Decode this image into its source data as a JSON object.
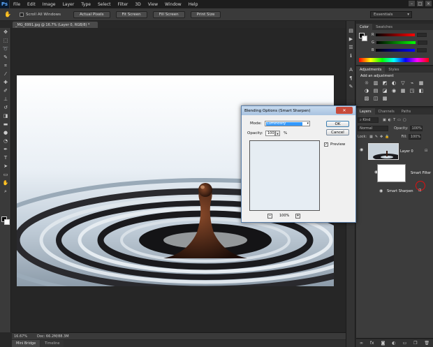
{
  "app": {
    "logo": "Ps"
  },
  "menu": [
    "File",
    "Edit",
    "Image",
    "Layer",
    "Type",
    "Select",
    "Filter",
    "3D",
    "View",
    "Window",
    "Help"
  ],
  "window_controls": [
    "–",
    "□",
    "×"
  ],
  "options_bar": {
    "scroll_all_label": "Scroll All Windows",
    "buttons": [
      "Actual Pixels",
      "Fit Screen",
      "Fill Screen",
      "Print Size"
    ],
    "workspace": "Essentials"
  },
  "document_tab": "_MG_6991.jpg @ 16.7% (Layer 0, RGB/8) *",
  "status": {
    "zoom": "16.67%",
    "doc": "Doc: 66.2M/88.3M"
  },
  "bottom_tabs": [
    "Mini Bridge",
    "Timeline"
  ],
  "color_panel": {
    "tabs": [
      "Color",
      "Swatches"
    ],
    "channels": [
      {
        "name": "R",
        "gradient": "linear-gradient(90deg,#000,#f00)"
      },
      {
        "name": "G",
        "gradient": "linear-gradient(90deg,#000,#0f0)"
      },
      {
        "name": "B",
        "gradient": "linear-gradient(90deg,#000,#00f)"
      }
    ]
  },
  "adjustments_panel": {
    "tabs": [
      "Adjustments",
      "Styles"
    ],
    "title": "Add an adjustment",
    "icons": [
      "☼",
      "▥",
      "◩",
      "◐",
      "▽",
      "⌁",
      "",
      "▦",
      "◑",
      "▤",
      "◪",
      "◉",
      "▦",
      "",
      "◳",
      "◧",
      "▨",
      "◫",
      "▩",
      "",
      ""
    ]
  },
  "layers_panel": {
    "tabs": [
      "Layers",
      "Channels",
      "Paths"
    ],
    "kind": "Kind",
    "blend_mode": "Normal",
    "opacity_label": "Opacity:",
    "opacity_value": "100%",
    "lock_label": "Lock:",
    "fill_label": "Fill:",
    "fill_value": "100%",
    "layer0": "Layer 0",
    "smart_filters": "Smart Filter",
    "smart_sharpen": "Smart Sharpen"
  },
  "dialog": {
    "title": "Blending Options (Smart Sharpen)",
    "close": "✕",
    "mode_label": "Mode:",
    "mode_value": "Luminosity",
    "opacity_label": "Opacity:",
    "opacity_value": "100",
    "opacity_unit": "%",
    "ok": "OK",
    "cancel": "Cancel",
    "preview": "Preview",
    "preview_zoom": "100%",
    "zoom_out": "−",
    "zoom_in": "+"
  }
}
